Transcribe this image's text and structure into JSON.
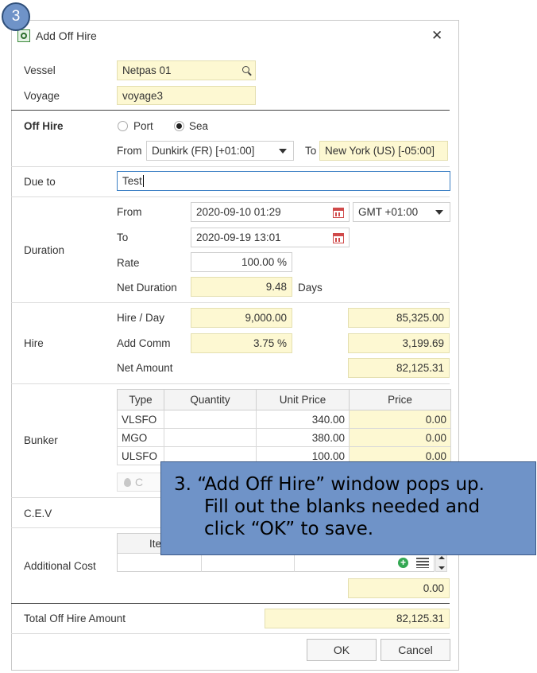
{
  "step_badge": "3",
  "dialog": {
    "title": "Add Off Hire",
    "close_glyph": "✕"
  },
  "vessel": {
    "label": "Vessel",
    "value": "Netpas 01"
  },
  "voyage": {
    "label": "Voyage",
    "value": "voyage3"
  },
  "off_hire": {
    "label": "Off Hire",
    "port_label": "Port",
    "sea_label": "Sea",
    "selected": "Sea",
    "from_label": "From",
    "from_value": "Dunkirk (FR) [+01:00]",
    "to_label": "To",
    "to_value": "New York (US) [-05:00]"
  },
  "due_to": {
    "label": "Due to",
    "value": "Test"
  },
  "duration": {
    "label": "Duration",
    "from_label": "From",
    "from_value": "2020-09-10 01:29",
    "timezone": "GMT +01:00",
    "to_label": "To",
    "to_value": "2020-09-19 13:01",
    "rate_label": "Rate",
    "rate_value": "100.00 %",
    "net_label": "Net Duration",
    "net_value": "9.48",
    "net_unit": "Days"
  },
  "hire": {
    "label": "Hire",
    "per_day_label": "Hire / Day",
    "per_day_value": "9,000.00",
    "per_day_total": "85,325.00",
    "add_comm_label": "Add Comm",
    "add_comm_value": "3.75 %",
    "add_comm_total": "3,199.69",
    "net_amount_label": "Net Amount",
    "net_amount_value": "82,125.31"
  },
  "bunker": {
    "label": "Bunker",
    "columns": [
      "Type",
      "Quantity",
      "Unit Price",
      "Price"
    ],
    "rows": [
      {
        "type": "VLSFO",
        "quantity": "",
        "unit_price": "340.00",
        "price": "0.00"
      },
      {
        "type": "MGO",
        "quantity": "",
        "unit_price": "380.00",
        "price": "0.00"
      },
      {
        "type": "ULSFO",
        "quantity": "",
        "unit_price": "100.00",
        "price": "0.00"
      }
    ],
    "partial_button": "C"
  },
  "cev": {
    "label": "C.E.V"
  },
  "additional_cost": {
    "label": "Additional Cost",
    "col_partial": "Ite",
    "total": "0.00"
  },
  "total": {
    "label": "Total Off Hire Amount",
    "value": "82,125.31"
  },
  "buttons": {
    "ok": "OK",
    "cancel": "Cancel"
  },
  "callout": {
    "line1": "3. “Add Off Hire” window pops up.",
    "line2": "Fill out the blanks needed and",
    "line3": "click “OK” to save."
  },
  "colors": {
    "accent": "#6f93c8",
    "readonly_field": "#fdf8d2",
    "focus_border": "#3b7fc4"
  }
}
